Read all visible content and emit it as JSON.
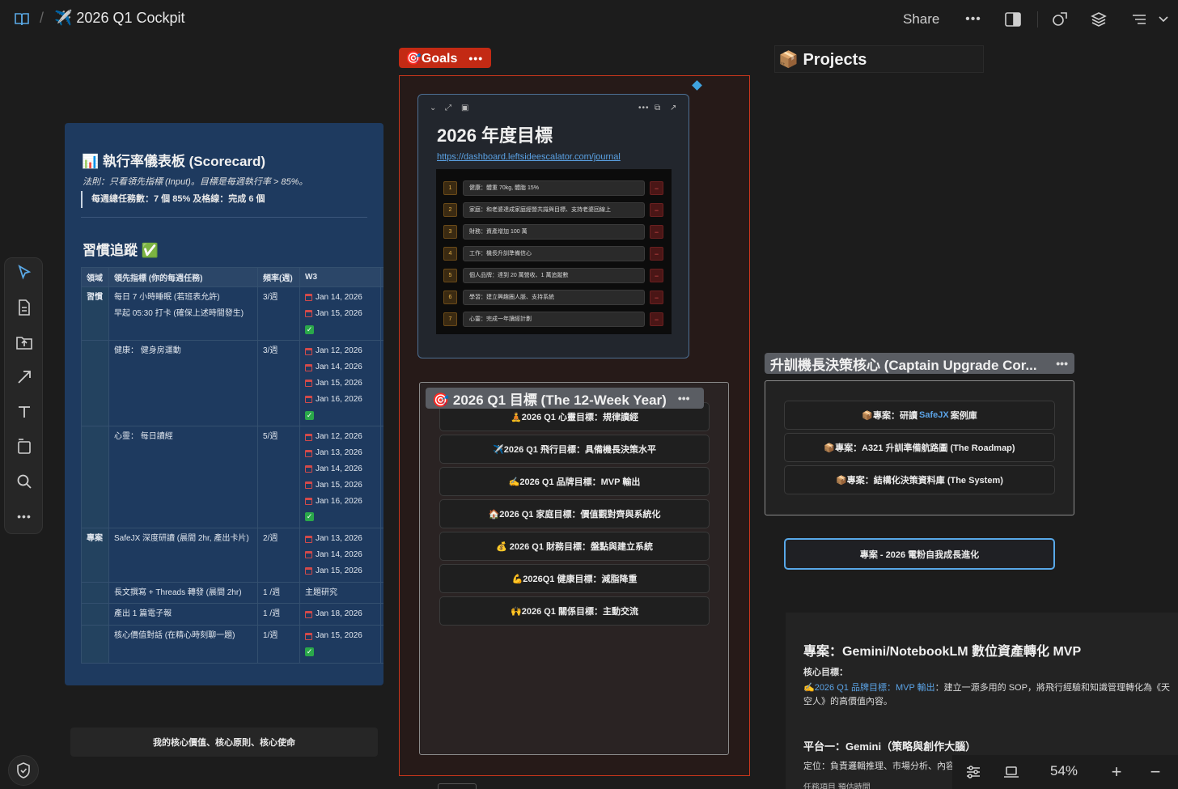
{
  "header": {
    "title": "✈️ 2026 Q1 Cockpit",
    "share_label": "Share",
    "more_label": "•••"
  },
  "scorecard": {
    "title": "📊 執行率儀表板 (Scorecard)",
    "rule": "法則：只看領先指標 (Input)。目標是每週執行率 > 85%。",
    "quote": "每週總任務數：7 個 85% 及格線：完成 6 個",
    "habit_title": "習慣追蹤 ✅",
    "columns": [
      "領域",
      "領先指標 (你的每週任務)",
      "頻率(週)",
      "W3",
      "W"
    ],
    "rows": [
      {
        "domain": "習慣",
        "tasks": [
          "每日 7 小時睡眠 (若班表允許)",
          "早起 05:30 打卡 (確保上述時間發生)"
        ],
        "freq": "3/週",
        "dates": [
          "Jan 14, 2026",
          "Jan 15, 2026"
        ],
        "check": true
      },
      {
        "domain": "",
        "tasks": [
          "健康： 健身房運動"
        ],
        "freq": "3/週",
        "dates": [
          "Jan 12, 2026",
          "Jan 14, 2026",
          "Jan 15, 2026",
          "Jan 16, 2026"
        ],
        "check": true
      },
      {
        "domain": "",
        "tasks": [
          "心靈： 每日讀經"
        ],
        "freq": "5/週",
        "dates": [
          "Jan 12, 2026",
          "Jan 13, 2026",
          "Jan 14, 2026",
          "Jan 15, 2026",
          "Jan 16, 2026"
        ],
        "check": true
      },
      {
        "domain": "專案",
        "tasks": [
          "SafeJX 深度研讀 (晨間 2hr, 產出卡片)"
        ],
        "freq": "2/週",
        "dates": [
          "Jan 13, 2026",
          "Jan 14, 2026",
          "Jan 15, 2026"
        ],
        "check": false
      },
      {
        "domain": "",
        "tasks": [
          "長文撰寫 + Threads 轉發 (晨間 2hr)"
        ],
        "freq": "1 /週",
        "text": "主題研究",
        "dates": [],
        "check": false
      },
      {
        "domain": "",
        "tasks": [
          "產出 1 篇電子報"
        ],
        "freq": "1 /週",
        "dates": [
          "Jan 18, 2026"
        ],
        "check": false
      },
      {
        "domain": "",
        "tasks": [
          "核心價值對話 (在精心時刻聊一題)"
        ],
        "freq": "1/週",
        "dates": [
          "Jan 15, 2026"
        ],
        "check": true
      }
    ],
    "check_glyph": "✓"
  },
  "core_values_label": "我的核心價值、核心原則、核心使命",
  "goals": {
    "label": "🎯Goals",
    "dots": "•••",
    "annual": {
      "title": "2026 年度目標",
      "link": "https://dashboard.leftsideescalator.com/journal",
      "delete_glyph": "−",
      "items": [
        {
          "num": "1",
          "text": "健康：體重 70kg, 體脂 15%"
        },
        {
          "num": "2",
          "text": "家庭：和老婆達成家庭經營共識與目標、支持老婆回線上"
        },
        {
          "num": "3",
          "text": "財務：資產增加 100 萬"
        },
        {
          "num": "4",
          "text": "工作：機長升訓準備信心"
        },
        {
          "num": "5",
          "text": "個人品牌：達到 20 萬營收、1 萬追蹤數"
        },
        {
          "num": "6",
          "text": "學習：建立興趣圈人脈、支持系統"
        },
        {
          "num": "7",
          "text": "心靈：完成一年讀經計劃"
        }
      ]
    },
    "q1_label": "🎯 2026 Q1 目標 (The 12-Week Year)",
    "q1_items": [
      "🧘2026 Q1 心靈目標：規律讀經",
      "✈️2026 Q1 飛行目標：具備機長決策水平",
      "✍️2026 Q1 品牌目標：MVP 輸出",
      "🏠2026 Q1 家庭目標：價值觀對齊與系統化",
      "💰 2026 Q1 財務目標：盤點與建立系統",
      "💪2026Q1 健康目標：減脂降重",
      "🙌2026 Q1 關係目標：主動交流"
    ]
  },
  "projects": {
    "label": "📦 Projects",
    "captain_label": "升訓機長決策核心 (Captain Upgrade Cor...",
    "captain_items": [
      {
        "pre": "📦專案：研讀 ",
        "hl": "SafeJX",
        "post": " 案例庫"
      },
      {
        "pre": "📦專案：A321 升訓準備航路圖 (The Roadmap)",
        "hl": "",
        "post": ""
      },
      {
        "pre": "📦專案：結構化決策資料庫 (The System)",
        "hl": "",
        "post": ""
      }
    ],
    "growth_button": "專案 - 2026 電粉自我成長進化",
    "gemini": {
      "title": "專案：Gemini/NotebookLM 數位資產轉化 MVP",
      "subtitle": "核心目標：",
      "body_link": "✍️2026 Q1 品牌目標：MVP 輸出",
      "body_text": "：建立一源多用的 SOP，將飛行經驗和知識管理轉化為《天空人》的高價值內容。",
      "platform": "平台一：Gemini（策略與創作大腦）",
      "position": "定位：負責邏輯推理、市場分析、內容",
      "table_head": "任務項目          預估時間"
    }
  },
  "zoom": {
    "value": "54%",
    "plus": "+",
    "minus": "−"
  }
}
